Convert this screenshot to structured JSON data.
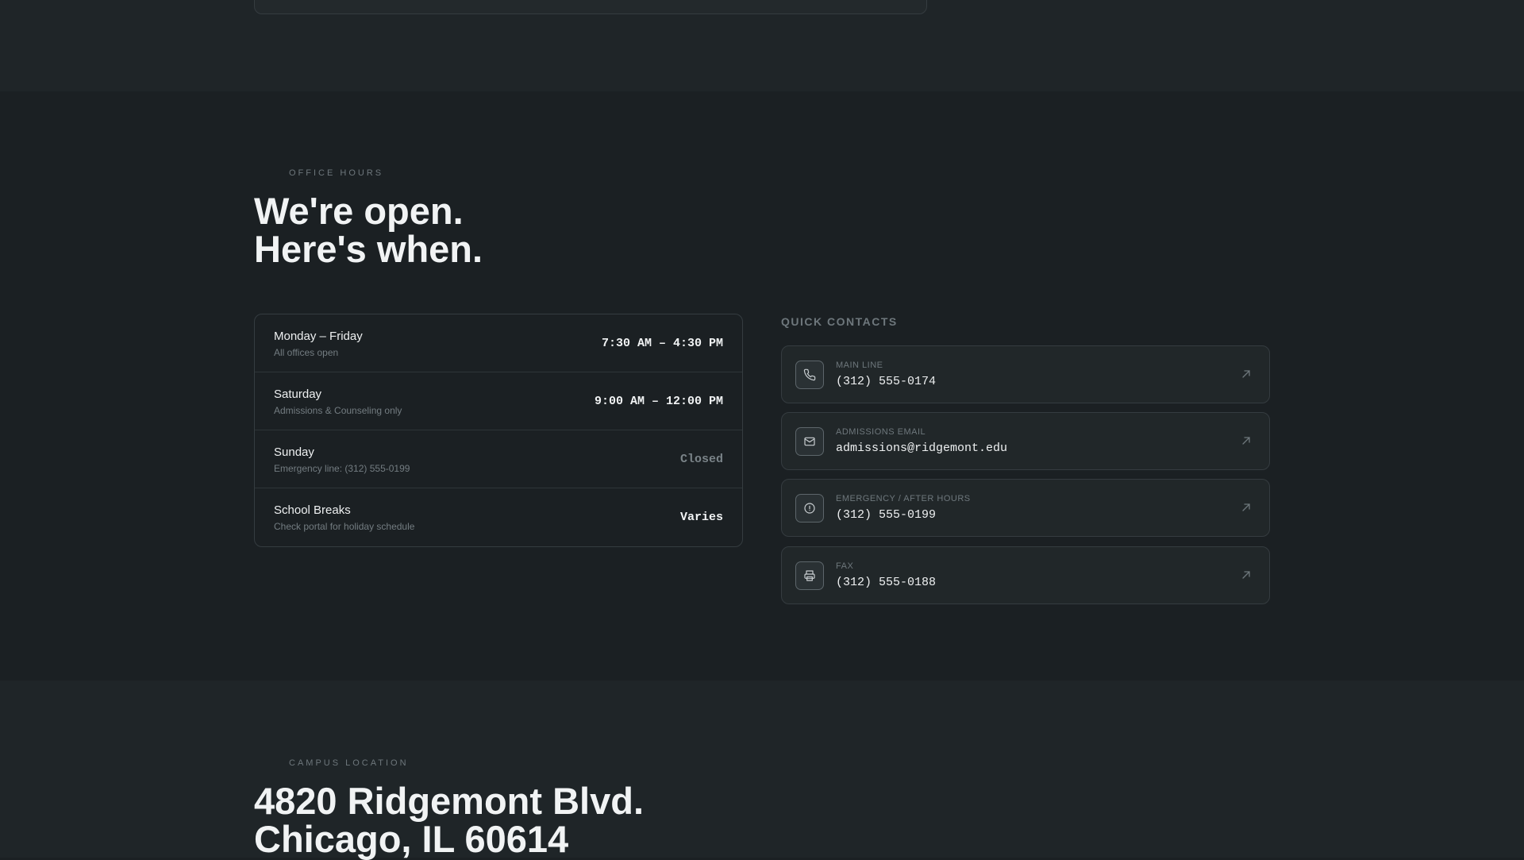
{
  "office_hours": {
    "eyebrow": "OFFICE HOURS",
    "headline_line1": "We're open.",
    "headline_line2": "Here's when.",
    "rows": [
      {
        "day": "Monday – Friday",
        "note": "All offices open",
        "time": "7:30 AM – 4:30 PM"
      },
      {
        "day": "Saturday",
        "note": "Admissions & Counseling only",
        "time": "9:00 AM – 12:00 PM"
      },
      {
        "day": "Sunday",
        "note": "Emergency line: (312) 555-0199",
        "time": "Closed"
      },
      {
        "day": "School Breaks",
        "note": "Check portal for holiday schedule",
        "time": "Varies"
      }
    ]
  },
  "quick_contacts": {
    "heading": "QUICK CONTACTS",
    "items": [
      {
        "icon": "phone-icon",
        "label": "MAIN LINE",
        "value": "(312) 555-0174"
      },
      {
        "icon": "mail-icon",
        "label": "ADMISSIONS EMAIL",
        "value": "admissions@ridgemont.edu"
      },
      {
        "icon": "alert-icon",
        "label": "EMERGENCY / AFTER HOURS",
        "value": "(312) 555-0199"
      },
      {
        "icon": "printer-icon",
        "label": "FAX",
        "value": "(312) 555-0188"
      }
    ]
  },
  "campus_location": {
    "eyebrow": "CAMPUS LOCATION",
    "address_line1": "4820 Ridgemont Blvd.",
    "address_line2": "Chicago, IL 60614"
  }
}
